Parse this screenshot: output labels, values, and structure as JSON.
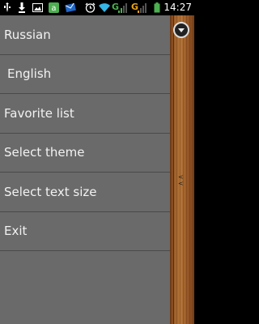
{
  "status_bar": {
    "time": "14:27",
    "network1": "G",
    "network2": "G",
    "battery_level": "100%",
    "icons": [
      "usb-icon",
      "download-icon",
      "gallery-icon",
      "app-store-icon",
      "email-icon",
      "alarm-icon",
      "wifi-icon",
      "signal-icon",
      "battery-icon"
    ]
  },
  "menu": {
    "items": [
      {
        "label": "Russian"
      },
      {
        "label": " English"
      },
      {
        "label": "Favorite list"
      },
      {
        "label": "Select theme"
      },
      {
        "label": "Select text size"
      },
      {
        "label": "Exit"
      }
    ]
  },
  "side": {
    "arrows": "< <"
  },
  "colors": {
    "menu_bg": "#6a6a6a",
    "divider": "#4a4a4a",
    "text": "#f2f2f2",
    "wood": "#a0622c",
    "accent_green": "#4caf50"
  }
}
